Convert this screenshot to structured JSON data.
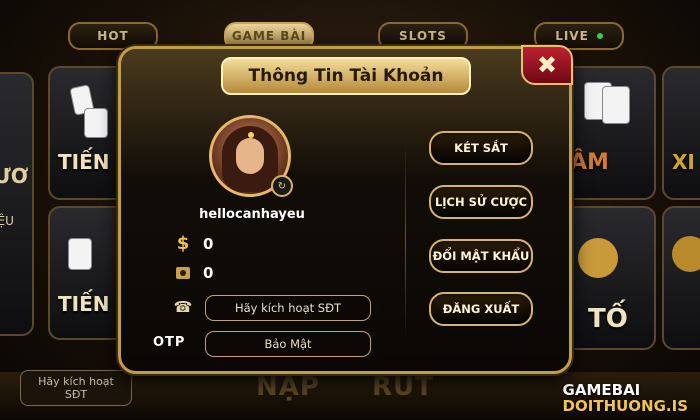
{
  "tabs": [
    {
      "label": "HOT"
    },
    {
      "label": "GAME BÀI"
    },
    {
      "label": "SLOTS"
    },
    {
      "label": "LIVE"
    }
  ],
  "background": {
    "tiles": [
      "TIẾN L",
      "TIẾN L",
      "ÂM",
      "XI",
      "TỐ"
    ],
    "side_button": "Hãy kích hoạt\nSĐT",
    "left_fragments": [
      "ƯƠ",
      "IỆU"
    ]
  },
  "bottom": {
    "deposit_label": "NẠP",
    "withdraw_label": "RÚT"
  },
  "logo": {
    "line1": "GAMEBAI",
    "line2": "DOITHUONG.IS"
  },
  "dialog": {
    "title": "Thông Tin Tài Khoản",
    "close_icon": "✖",
    "username": "hellocanhayeu",
    "balance": "0",
    "safe_balance": "0",
    "phone_field": "Hãy kích hoạt SĐT",
    "otp_label": "OTP",
    "otp_field": "Bảo Mật",
    "actions": [
      {
        "label": "KÉT SẮT"
      },
      {
        "label": "LỊCH SỬ CƯỢC"
      },
      {
        "label": "ĐỔI MẬT KHẨU"
      },
      {
        "label": "ĐĂNG XUẤT"
      }
    ]
  },
  "colors": {
    "gold": "#d8b467",
    "close_red": "#c02030",
    "live_green": "#35d04a"
  }
}
